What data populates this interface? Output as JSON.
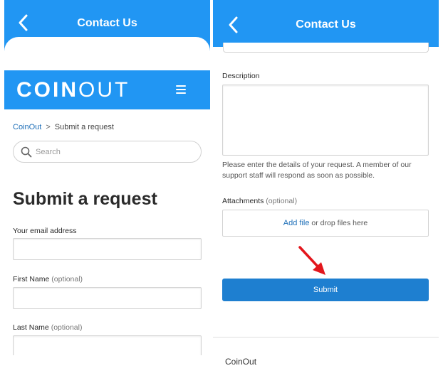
{
  "colors": {
    "header_blue": "#2196f3",
    "button_blue": "#1e7fd0",
    "link_blue": "#1e6fb8",
    "arrow_red": "#e3161c"
  },
  "left_screen": {
    "header": {
      "title": "Contact Us",
      "back_icon": "chevron-left-icon"
    },
    "brand": {
      "logo_bold": "COIN",
      "logo_light": "OUT",
      "menu_icon": "hamburger-menu-icon"
    },
    "breadcrumb": {
      "home": "CoinOut",
      "separator": ">",
      "current": "Submit a request"
    },
    "search": {
      "placeholder": "Search",
      "value": "",
      "icon": "search-icon"
    },
    "heading": "Submit a request",
    "fields": {
      "email": {
        "label": "Your email address",
        "value": ""
      },
      "first_name": {
        "label": "First Name",
        "optional": "(optional)",
        "value": ""
      },
      "last_name": {
        "label": "Last Name",
        "optional": "(optional)",
        "value": ""
      }
    }
  },
  "right_screen": {
    "header": {
      "title": "Contact Us",
      "back_icon": "chevron-left-icon"
    },
    "description": {
      "label": "Description",
      "value": "",
      "hint": "Please enter the details of your request. A member of our support staff will respond as soon as possible."
    },
    "attachments": {
      "label": "Attachments",
      "optional": "(optional)",
      "add_file": "Add file",
      "drop_text": " or drop files here"
    },
    "annotation_icon": "red-arrow-icon",
    "submit_label": "Submit",
    "footer_brand": "CoinOut"
  }
}
